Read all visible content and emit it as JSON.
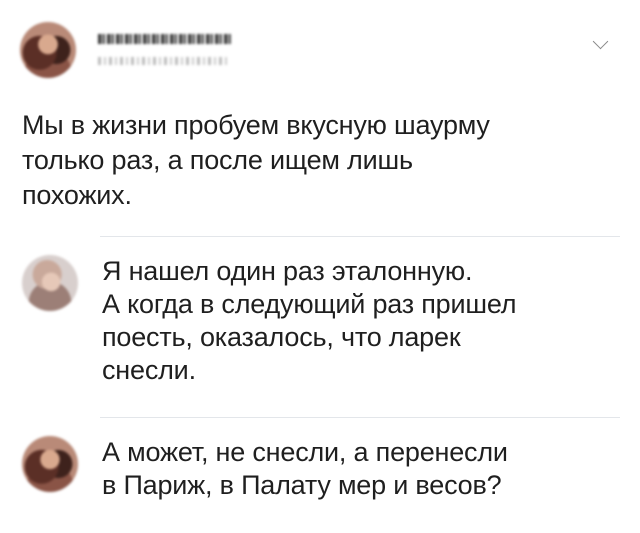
{
  "tweet": {
    "text_lines": [
      "Мы в жизни пробуем вкусную шаурму",
      "только раз, а после ищем лишь",
      "похожих."
    ]
  },
  "replies": [
    {
      "text_lines": [
        "Я нашел один раз эталонную.",
        "А когда в следующий раз пришел",
        "поесть, оказалось, что ларек",
        "снесли."
      ]
    },
    {
      "text_lines": [
        "А может, не снесли, а перенесли",
        "в Париж, в Палату мер и весов?"
      ]
    }
  ],
  "icons": {
    "menu": "chevron-down-icon"
  },
  "colors": {
    "text": "#1f1f1f",
    "divider": "#e3e6ea",
    "chevron": "#8a8a8a"
  }
}
